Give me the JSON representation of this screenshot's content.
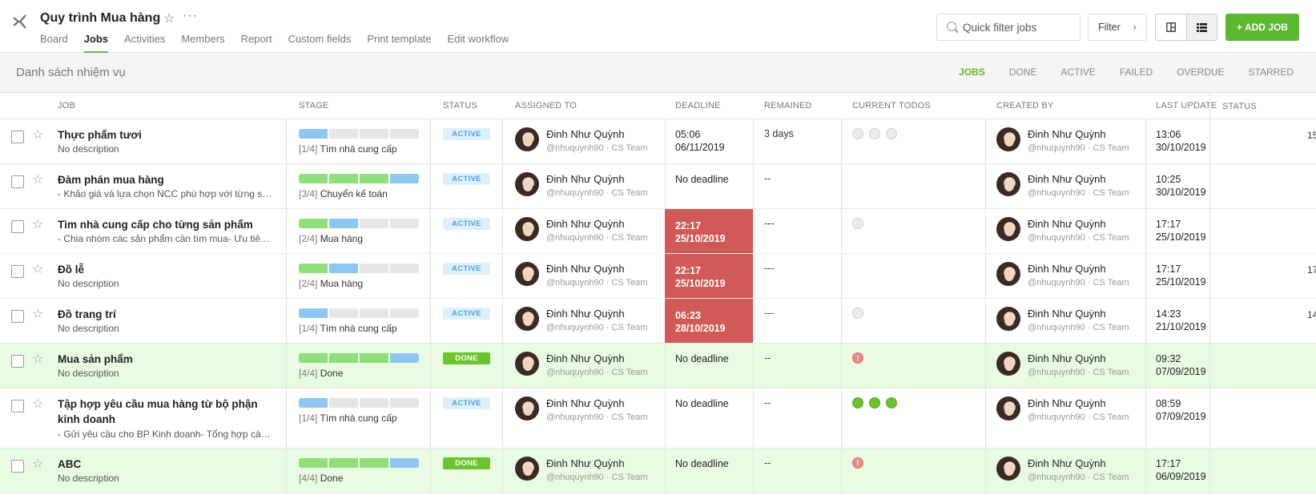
{
  "header": {
    "title": "Quy trình Mua hàng",
    "tabs": [
      "Board",
      "Jobs",
      "Activities",
      "Members",
      "Report",
      "Custom fields",
      "Print template",
      "Edit workflow"
    ],
    "search_placeholder": "Quick filter jobs",
    "filter_label": "Filter",
    "add_label": "+ ADD JOB"
  },
  "subbar": {
    "title": "Danh sách nhiệm vụ",
    "filters": [
      "JOBS",
      "DONE",
      "ACTIVE",
      "FAILED",
      "OVERDUE",
      "STARRED"
    ]
  },
  "columns": [
    "JOB",
    "STAGE",
    "STATUS",
    "ASSIGNED TO",
    "DEADLINE",
    "REMAINED",
    "CURRENT TODOS",
    "CREATED BY",
    "LAST UPDATE",
    "STATUS"
  ],
  "rows": [
    {
      "name": "Thực phẩm tươi",
      "desc": "No description",
      "stage_index": "[1/4]",
      "stage": "Tìm nhà cung cấp",
      "status": "ACTIVE",
      "assignee": "Đinh Như Quỳnh",
      "handle": "@nhuquynh90 · CS Team",
      "deadline1": "05:06",
      "deadline2": "06/11/2019",
      "remained": "3 days",
      "creator": "Đinh Như Quỳnh",
      "creator_handle": "@nhuquynh90 · CS Team",
      "upd1": "13:06",
      "upd2": "30/10/2019",
      "trail": "15"
    },
    {
      "name": "Đàm phán mua hàng",
      "desc": "- Khảo giá và lựa chọn NCC phù hợp với từng sả...",
      "stage_index": "[3/4]",
      "stage": "Chuyển kế toán",
      "status": "ACTIVE",
      "assignee": "Đinh Như Quỳnh",
      "handle": "@nhuquynh90 · CS Team",
      "deadline1": "No deadline",
      "deadline2": "",
      "remained": "--",
      "creator": "Đinh Như Quỳnh",
      "creator_handle": "@nhuquynh90 · CS Team",
      "upd1": "10:25",
      "upd2": "30/10/2019",
      "trail": ""
    },
    {
      "name": "Tìm nhà cung cấp cho từng sản phẩm",
      "desc": "- Chia nhóm các sản phẩm cần tìm mua- Ưu tiên ...",
      "stage_index": "[2/4]",
      "stage": "Mua hàng",
      "status": "ACTIVE",
      "assignee": "Đinh Như Quỳnh",
      "handle": "@nhuquynh90 · CS Team",
      "deadline1": "22:17",
      "deadline2": "25/10/2019",
      "remained": "---",
      "creator": "Đinh Như Quỳnh",
      "creator_handle": "@nhuquynh90 · CS Team",
      "upd1": "17:17",
      "upd2": "25/10/2019",
      "trail": ""
    },
    {
      "name": "Đồ lễ",
      "desc": "No description",
      "stage_index": "[2/4]",
      "stage": "Mua hàng",
      "status": "ACTIVE",
      "assignee": "Đinh Như Quỳnh",
      "handle": "@nhuquynh90 · CS Team",
      "deadline1": "22:17",
      "deadline2": "25/10/2019",
      "remained": "---",
      "creator": "Đinh Như Quỳnh",
      "creator_handle": "@nhuquynh90 · CS Team",
      "upd1": "17:17",
      "upd2": "25/10/2019",
      "trail": "17"
    },
    {
      "name": "Đồ trang trí",
      "desc": "No description",
      "stage_index": "[1/4]",
      "stage": "Tìm nhà cung cấp",
      "status": "ACTIVE",
      "assignee": "Đinh Như Quỳnh",
      "handle": "@nhuquynh90 · CS Team",
      "deadline1": "06:23",
      "deadline2": "28/10/2019",
      "remained": "---",
      "creator": "Đinh Như Quỳnh",
      "creator_handle": "@nhuquynh90 · CS Team",
      "upd1": "14:23",
      "upd2": "21/10/2019",
      "trail": "14"
    },
    {
      "name": "Mua sản phẩm",
      "desc": "No description",
      "stage_index": "[4/4]",
      "stage": "Done",
      "status": "DONE",
      "assignee": "Đinh Như Quỳnh",
      "handle": "@nhuquynh90 · CS Team",
      "deadline1": "No deadline",
      "deadline2": "",
      "remained": "--",
      "creator": "Đinh Như Quỳnh",
      "creator_handle": "@nhuquynh90 · CS Team",
      "upd1": "09:32",
      "upd2": "07/09/2019",
      "trail": ""
    },
    {
      "name": "Tập hợp yêu cầu mua hàng từ bộ phận kinh doanh",
      "desc": "- Gửi yêu cầu cho BP Kinh doanh- Tổng hợp các ...",
      "stage_index": "[1/4]",
      "stage": "Tìm nhà cung cấp",
      "status": "ACTIVE",
      "assignee": "Đinh Như Quỳnh",
      "handle": "@nhuquynh90 · CS Team",
      "deadline1": "No deadline",
      "deadline2": "",
      "remained": "--",
      "creator": "Đinh Như Quỳnh",
      "creator_handle": "@nhuquynh90 · CS Team",
      "upd1": "08:59",
      "upd2": "07/09/2019",
      "trail": ""
    },
    {
      "name": "ABC",
      "desc": "No description",
      "stage_index": "[4/4]",
      "stage": "Done",
      "status": "DONE",
      "assignee": "Đinh Như Quỳnh",
      "handle": "@nhuquynh90 · CS Team",
      "deadline1": "No deadline",
      "deadline2": "",
      "remained": "--",
      "creator": "Đinh Như Quỳnh",
      "creator_handle": "@nhuquynh90 · CS Team",
      "upd1": "17:17",
      "upd2": "06/09/2019",
      "trail": ""
    }
  ],
  "todo_warn_glyph": "!",
  "colors": {
    "accent": "#5cb82e",
    "overdue": "#cf5a57",
    "done_row": "#eafbe4",
    "active_badge": "#4aa3df"
  }
}
